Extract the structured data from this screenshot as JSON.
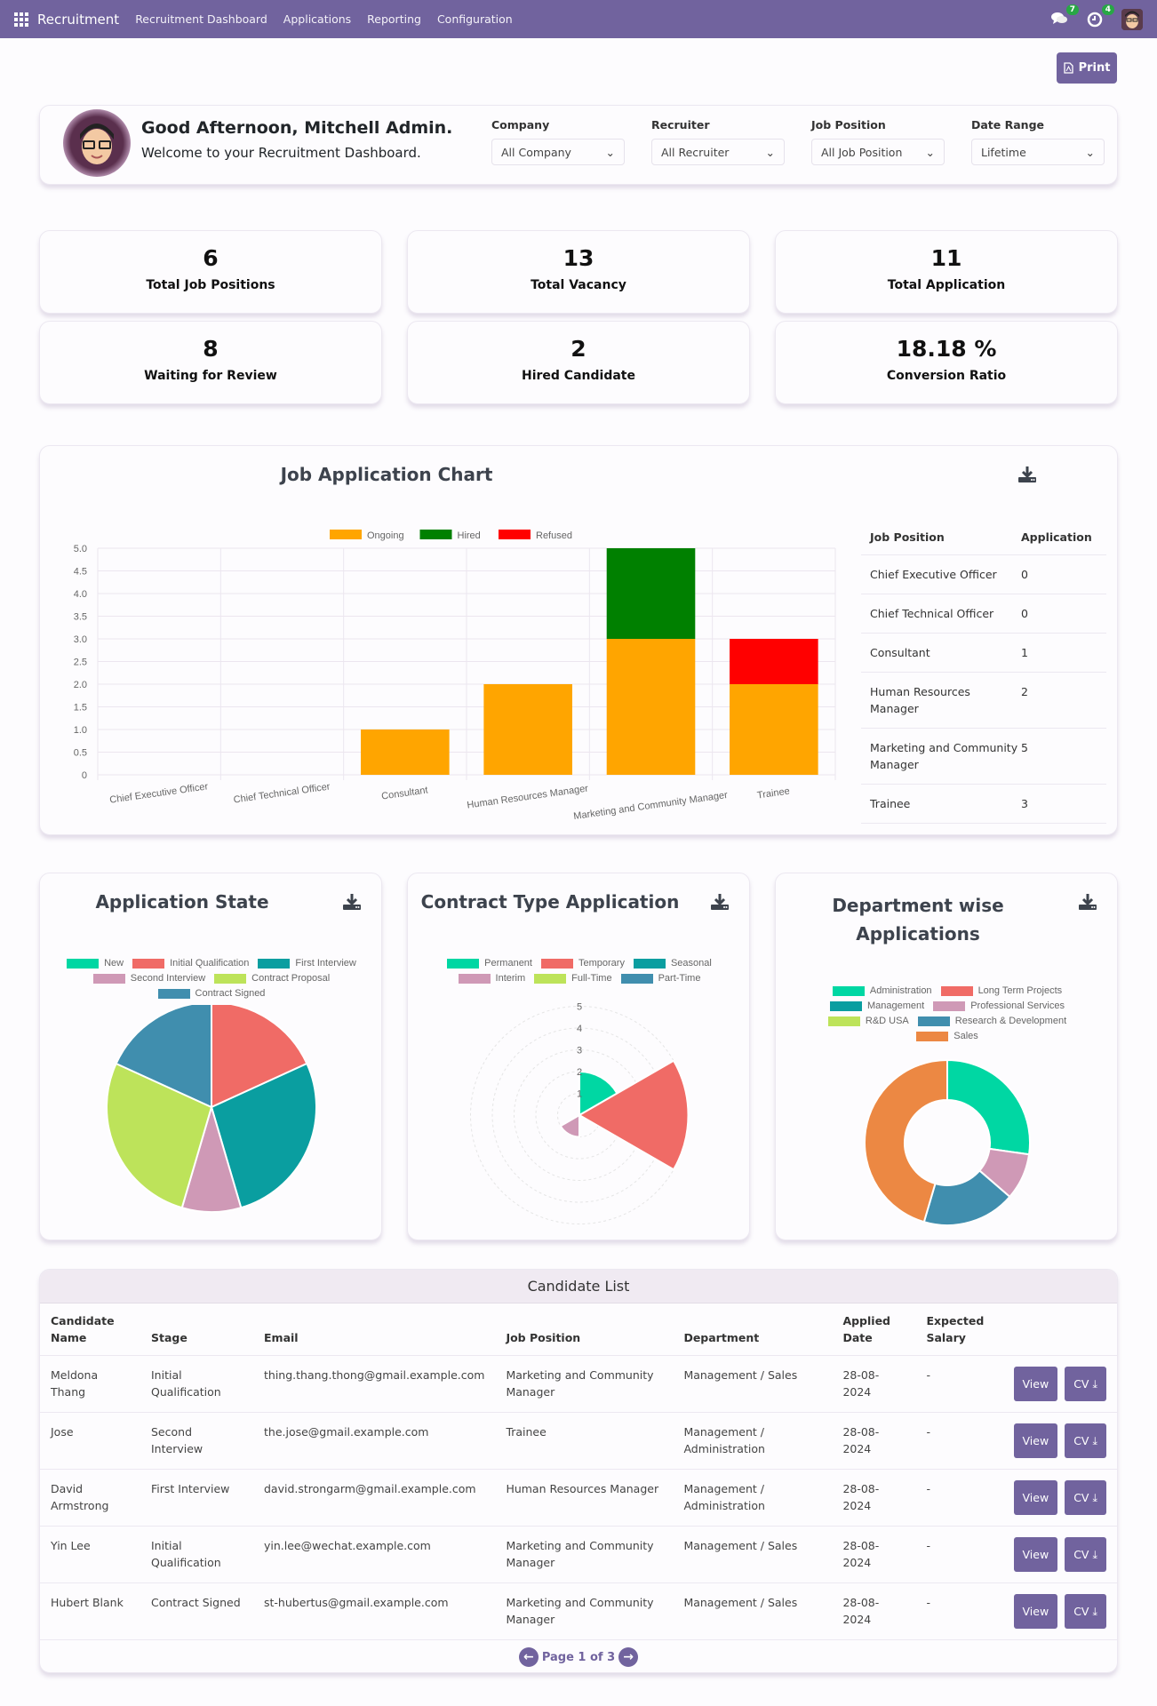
{
  "navbar": {
    "app_name": "Recruitment",
    "menu": [
      "Recruitment Dashboard",
      "Applications",
      "Reporting",
      "Configuration"
    ],
    "messages_count": "7",
    "activities_count": "4"
  },
  "toolbar": {
    "print_label": "Print"
  },
  "welcome": {
    "title": "Good Afternoon, Mitchell Admin.",
    "subtitle": "Welcome to your Recruitment Dashboard."
  },
  "filters": [
    {
      "label": "Company",
      "value": "All Company"
    },
    {
      "label": "Recruiter",
      "value": "All Recruiter"
    },
    {
      "label": "Job Position",
      "value": "All Job Position"
    },
    {
      "label": "Date Range",
      "value": "Lifetime"
    }
  ],
  "kpis": [
    {
      "value": "6",
      "label": "Total Job Positions"
    },
    {
      "value": "13",
      "label": "Total Vacancy"
    },
    {
      "value": "11",
      "label": "Total Application"
    },
    {
      "value": "8",
      "label": "Waiting for Review"
    },
    {
      "value": "2",
      "label": "Hired Candidate"
    },
    {
      "value": "18.18 %",
      "label": "Conversion Ratio"
    }
  ],
  "job_table": {
    "headers": [
      "Job Position",
      "Application"
    ],
    "rows": [
      [
        "Chief Executive Officer",
        "0"
      ],
      [
        "Chief Technical Officer",
        "0"
      ],
      [
        "Consultant",
        "1"
      ],
      [
        "Human Resources Manager",
        "2"
      ],
      [
        "Marketing and Community Manager",
        "5"
      ],
      [
        "Trainee",
        "3"
      ]
    ]
  },
  "chart_data": [
    {
      "type": "bar",
      "stacked": true,
      "title": "Job Application Chart",
      "categories": [
        "Chief Executive Officer",
        "Chief Technical Officer",
        "Consultant",
        "Human Resources Manager",
        "Marketing and Community Manager",
        "Trainee"
      ],
      "series": [
        {
          "name": "Ongoing",
          "color": "#ffa500",
          "values": [
            0,
            0,
            1,
            2,
            3,
            2
          ]
        },
        {
          "name": "Hired",
          "color": "#008000",
          "values": [
            0,
            0,
            0,
            0,
            2,
            0
          ]
        },
        {
          "name": "Refused",
          "color": "#ff0000",
          "values": [
            0,
            0,
            0,
            0,
            0,
            1
          ]
        }
      ],
      "ylim": [
        0,
        5
      ],
      "yticks": [
        "0",
        "0.5",
        "1.0",
        "1.5",
        "2.0",
        "2.5",
        "3.0",
        "3.5",
        "4.0",
        "4.5",
        "5.0"
      ],
      "legend": "top",
      "grid": true
    },
    {
      "type": "pie",
      "title": "Application State",
      "labels": [
        "New",
        "Initial Qualification",
        "First Interview",
        "Second Interview",
        "Contract Proposal",
        "Contract Signed"
      ],
      "values": [
        0,
        2,
        3,
        1,
        3,
        2
      ],
      "colors": [
        "#00d7a3",
        "#f06b66",
        "#0a9ea0",
        "#cf99b6",
        "#bde35a",
        "#408eae"
      ],
      "legend": "top"
    },
    {
      "type": "polarArea",
      "title": "Contract Type Application",
      "labels": [
        "Permanent",
        "Temporary",
        "Seasonal",
        "Interim",
        "Full-Time",
        "Part-Time"
      ],
      "values": [
        2,
        5,
        0,
        1,
        0,
        0
      ],
      "colors": [
        "#00d7a3",
        "#f06b66",
        "#0a9ea0",
        "#cf99b6",
        "#bde35a",
        "#408eae"
      ],
      "rticks": [
        "1",
        "2",
        "3",
        "4",
        "5"
      ],
      "legend": "top"
    },
    {
      "type": "doughnut",
      "title": "Department wise Applications",
      "labels": [
        "Administration",
        "Long Term Projects",
        "Management",
        "Professional Services",
        "R&D USA",
        "Research & Development",
        "Sales"
      ],
      "values": [
        3,
        0,
        0,
        1,
        0,
        2,
        5
      ],
      "colors": [
        "#00d7a3",
        "#f06b66",
        "#0a9ea0",
        "#cf99b6",
        "#bde35a",
        "#408eae",
        "#ec8843"
      ],
      "legend": "top"
    }
  ],
  "candidates": {
    "title": "Candidate List",
    "headers": [
      "Candidate Name",
      "Stage",
      "Email",
      "Job Position",
      "Department",
      "Applied Date",
      "Expected Salary"
    ],
    "rows": [
      [
        "Meldona Thang",
        "Initial Qualification",
        "thing.thang.thong@gmail.example.com",
        "Marketing and Community Manager",
        "Management / Sales",
        "28-08-2024",
        "-"
      ],
      [
        "Jose",
        "Second Interview",
        "the.jose@gmail.example.com",
        "Trainee",
        "Management / Administration",
        "28-08-2024",
        "-"
      ],
      [
        "David Armstrong",
        "First Interview",
        "david.strongarm@gmail.example.com",
        "Human Resources Manager",
        "Management / Administration",
        "28-08-2024",
        "-"
      ],
      [
        "Yin Lee",
        "Initial Qualification",
        "yin.lee@wechat.example.com",
        "Marketing and Community Manager",
        "Management / Sales",
        "28-08-2024",
        "-"
      ],
      [
        "Hubert Blank",
        "Contract Signed",
        "st-hubertus@gmail.example.com",
        "Marketing and Community Manager",
        "Management / Sales",
        "28-08-2024",
        "-"
      ]
    ],
    "view_label": "View",
    "cv_label": "CV",
    "pager": "Page 1 of 3"
  }
}
